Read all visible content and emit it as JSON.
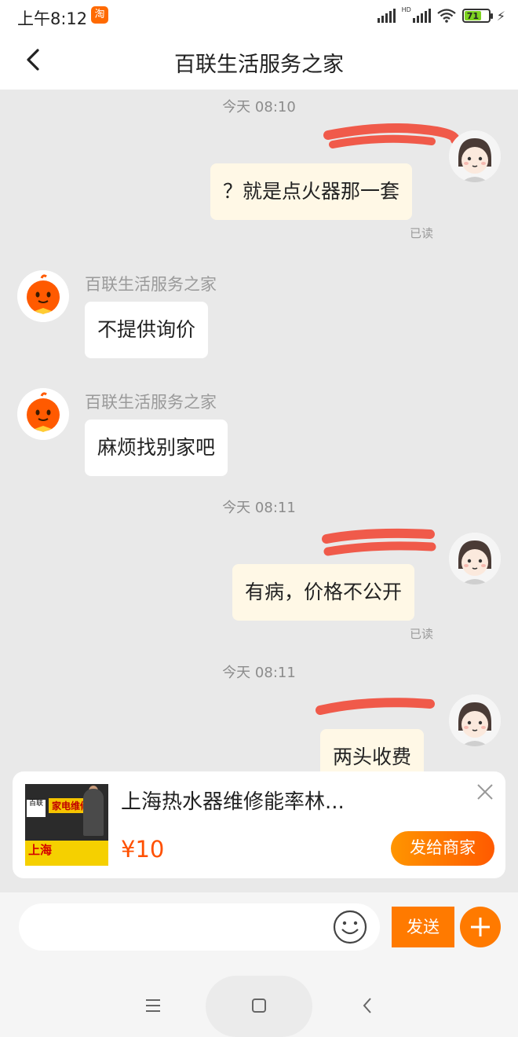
{
  "status_bar": {
    "time": "上午8:12",
    "app_icon": "taobao-icon",
    "battery": "71",
    "signal_label": "HD"
  },
  "header": {
    "title": "百联生活服务之家",
    "back_icon": "back-arrow-icon"
  },
  "messages": [
    {
      "type": "timestamp",
      "text": "今天 08:10"
    },
    {
      "type": "outgoing",
      "text": "？就是点火器那一套",
      "status": "已读",
      "nickname_redacted": true
    },
    {
      "type": "incoming",
      "sender": "百联生活服务之家",
      "text": "不提供询价"
    },
    {
      "type": "incoming",
      "sender": "百联生活服务之家",
      "text": "麻烦找别家吧"
    },
    {
      "type": "timestamp",
      "text": "今天 08:11"
    },
    {
      "type": "outgoing",
      "text": "有病，价格不公开",
      "status": "已读",
      "nickname_redacted": true
    },
    {
      "type": "timestamp",
      "text": "今天 08:11"
    },
    {
      "type": "outgoing",
      "text": "两头收费",
      "nickname_redacted": true
    }
  ],
  "product_card": {
    "title": "上海热水器维修能率林...",
    "price": "¥10",
    "action_label": "发给商家",
    "image_text_brand": "百联",
    "image_text_banner": "家电维修",
    "image_text_city": "上海",
    "close_icon": "close-icon"
  },
  "input_bar": {
    "placeholder": "",
    "send_label": "发送",
    "emoji_icon": "smiley-icon",
    "plus_icon": "plus-icon"
  },
  "nav_bar": {
    "menu_icon": "menu-icon",
    "home_icon": "home-square-icon",
    "back_icon": "back-triangle-icon"
  },
  "colors": {
    "accent": "#ff7a00",
    "price": "#ff5000",
    "chat_bg": "#e9e9e9",
    "mine_bubble": "#fff8e6",
    "redaction": "#f05a4a"
  }
}
